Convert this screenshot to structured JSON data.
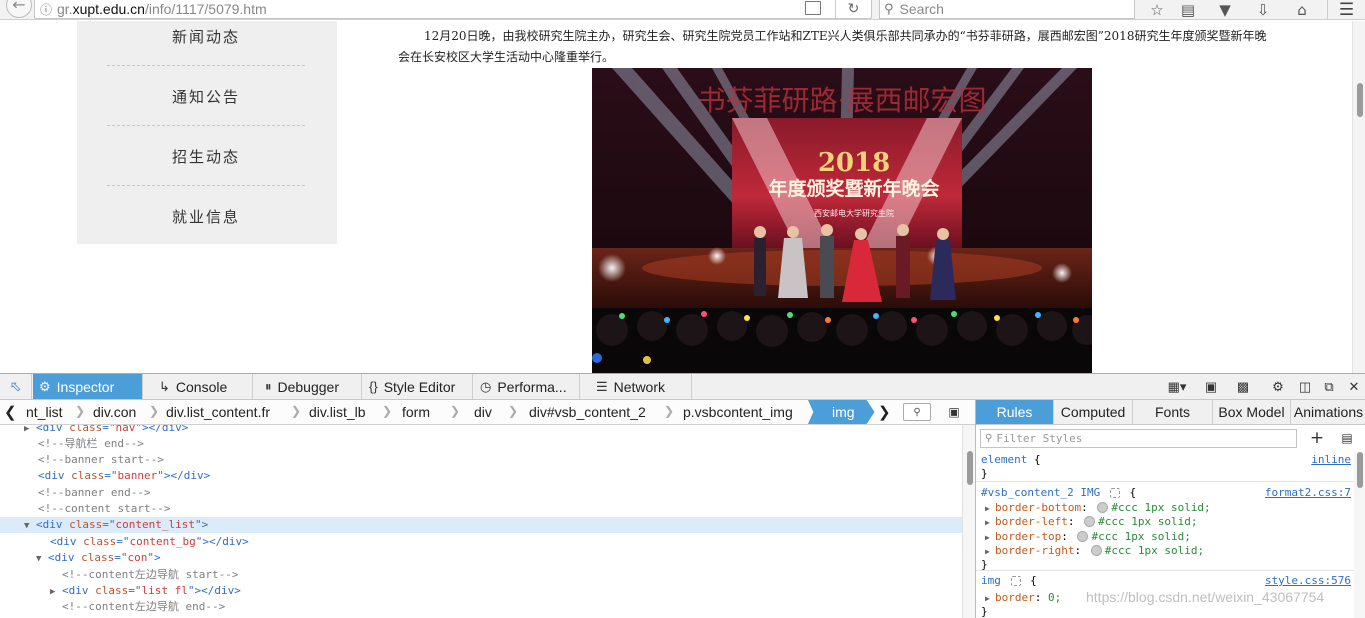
{
  "browser": {
    "url_prefix": "gr.",
    "url_domain": "xupt.edu.cn",
    "url_path": "/info/1117/5079.htm",
    "search_placeholder": "Search"
  },
  "page": {
    "sidebar_items": [
      "新闻动态",
      "通知公告",
      "招生动态",
      "就业信息"
    ],
    "article_text": "12月20日晚，由我校研究生院主办，研究生会、研究生院党员工作站和ZTE兴人类俱乐部共同承办的“书芬菲研路，展西邮宏图”2018研究生年度颁奖暨新年晚会在长安校区大学生活动中心隆重举行。",
    "photo": {
      "banner_text": "书芬菲研路·展西邮宏图",
      "year_text": "2018",
      "screen_title": "年度颁奖暨新年晚会",
      "screen_subtitle": "西安邮电大学研究生院"
    }
  },
  "devtools": {
    "tabs": [
      {
        "label": "Inspector",
        "icon": "inspector-icon"
      },
      {
        "label": "Console",
        "icon": "console-icon"
      },
      {
        "label": "Debugger",
        "icon": "debugger-icon"
      },
      {
        "label": "Style Editor",
        "icon": "style-editor-icon"
      },
      {
        "label": "Performa...",
        "icon": "performance-icon"
      },
      {
        "label": "Network",
        "icon": "network-icon"
      }
    ],
    "breadcrumbs": [
      "nt_list",
      "div.con",
      "div.list_content.fr",
      "div.list_lb",
      "form",
      "div",
      "div#vsb_content_2",
      "p.vsbcontent_img",
      "img"
    ],
    "markup": {
      "l0": {
        "tag": "div",
        "attr": "class",
        "val": "nav",
        "tail": "></",
        "close": "div",
        "end": ">"
      },
      "l1": "<!--导航栏 end-->",
      "l2": {
        "tag": "div",
        "attr": "class",
        "val": "banner",
        "tail": "></",
        "close": "div",
        "end": ">"
      },
      "l3": "<!--banner start-->",
      "l4": "<!--banner end-->",
      "l5": "<!--content start-->",
      "l6": {
        "tag": "div",
        "attr": "class",
        "val": "content_list",
        "end": ">"
      },
      "l7": {
        "tag": "div",
        "attr": "class",
        "val": "content_bg",
        "tail": "></",
        "close": "div",
        "end": ">"
      },
      "l8": {
        "tag": "div",
        "attr": "class",
        "val": "con",
        "end": ">"
      },
      "l9": "<!--content左边导航 start-->",
      "l10": {
        "tag": "div",
        "attr": "class",
        "val": "list fl",
        "tail": "></",
        "close": "div",
        "end": ">"
      },
      "l11": "<!--content左边导航 end-->",
      "eq": "=",
      "q": "\"",
      "lt": "<"
    },
    "side_tabs": [
      "Rules",
      "Computed",
      "Fonts",
      "Box Model",
      "Animations"
    ],
    "filter_placeholder": "Filter Styles",
    "rules": {
      "r1_selector": "element",
      "r1_open": " {",
      "r1_source": "inline",
      "close_brace": "}",
      "r2_selector": "#vsb_content_2 IMG",
      "r2_source": "format2.css:7",
      "r2_props": [
        {
          "name": "border-bottom",
          "value": "#ccc 1px solid;"
        },
        {
          "name": "border-left",
          "value": "#ccc 1px solid;"
        },
        {
          "name": "border-top",
          "value": "#ccc 1px solid;"
        },
        {
          "name": "border-right",
          "value": "#ccc 1px solid;"
        }
      ],
      "r3_selector": "img",
      "r3_source": "style.css:576",
      "r3_prop": "border",
      "r3_value": "0;",
      "colon": ": ",
      "brace_open": "{"
    },
    "watermark": "https://blog.csdn.net/weixin_43067754"
  }
}
